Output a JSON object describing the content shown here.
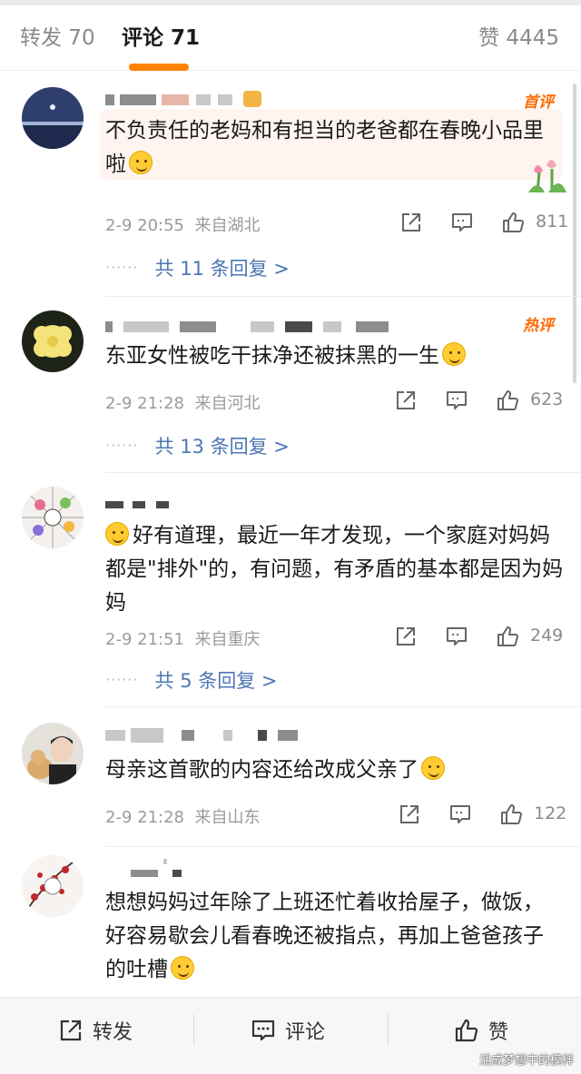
{
  "tabs": {
    "repost": "转发 70",
    "comment": "评论 71",
    "like": "赞 4445"
  },
  "comments": [
    {
      "badge": "首评",
      "text": "不负责任的老妈和有担当的老爸都在春晚小品里啦",
      "time": "2-9 20:55",
      "location": "来自湖北",
      "likes": "811",
      "replies": "共 11 条回复 >"
    },
    {
      "badge": "热评",
      "text": "东亚女性被吃干抹净还被抹黑的一生",
      "time": "2-9 21:28",
      "location": "来自河北",
      "likes": "623",
      "replies": "共 13 条回复 >"
    },
    {
      "text": "好有道理，最近一年才发现，一个家庭对妈妈都是\"排外\"的，有问题，有矛盾的基本都是因为妈妈",
      "time": "2-9 21:51",
      "location": "来自重庆",
      "likes": "249",
      "replies": "共 5 条回复 >"
    },
    {
      "text": "母亲这首歌的内容还给改成父亲了",
      "time": "2-9 21:28",
      "location": "来自山东",
      "likes": "122"
    },
    {
      "text": "想想妈妈过年除了上班还忙着收拾屋子，做饭，好容易歇会儿看春晚还被指点，再加上爸爸孩子的吐槽"
    }
  ],
  "bottom_bar": {
    "repost": "转发",
    "comment": "评论",
    "like": "赞",
    "watermark": "活成梦想中的模样"
  },
  "icons": {
    "share": "share-icon",
    "comment": "comment-icon",
    "like": "thumbs-up-icon"
  },
  "colors": {
    "accent": "#ff8200",
    "link": "#4c76b3",
    "badge": "#ff6a00"
  }
}
